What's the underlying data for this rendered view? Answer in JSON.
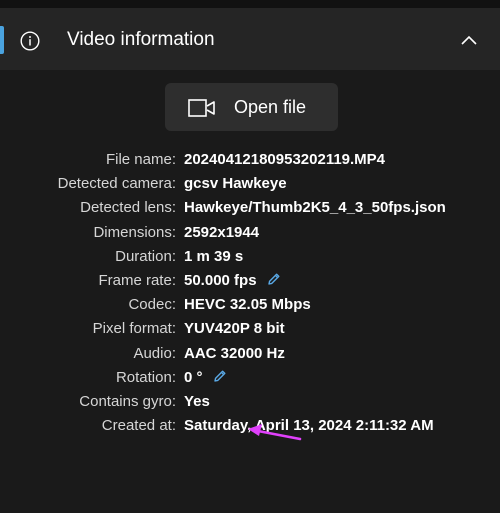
{
  "header": {
    "title": "Video information",
    "info_icon": "info-circle-icon",
    "collapse_icon": "chevron-up-icon",
    "accent_color": "#4aa3df"
  },
  "open_button": {
    "label": "Open file",
    "icon": "video-camera-icon"
  },
  "fields": [
    {
      "label": "File name:",
      "value": "20240412180953202119.MP4"
    },
    {
      "label": "Detected camera:",
      "value": "gcsv Hawkeye"
    },
    {
      "label": "Detected lens:",
      "value": "Hawkeye/Thumb2K5_4_3_50fps.json"
    },
    {
      "label": "Dimensions:",
      "value": "2592x1944"
    },
    {
      "label": "Duration:",
      "value": "1 m 39 s"
    },
    {
      "label": "Frame rate:",
      "value": "50.000 fps",
      "editable": true
    },
    {
      "label": "Codec:",
      "value": "HEVC 32.05 Mbps"
    },
    {
      "label": "Pixel format:",
      "value": "YUV420P 8 bit"
    },
    {
      "label": "Audio:",
      "value": "AAC 32000 Hz"
    },
    {
      "label": "Rotation:",
      "value": "0 °",
      "editable": true
    },
    {
      "label": "Contains gyro:",
      "value": "Yes"
    },
    {
      "label": "Created at:",
      "value": "Saturday, April 13, 2024 2:11:32 AM"
    }
  ],
  "annotation": {
    "arrow_color": "#e040fb"
  }
}
